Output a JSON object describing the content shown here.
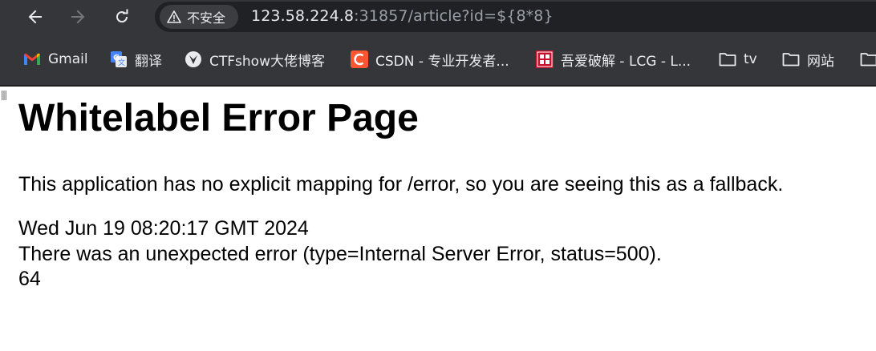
{
  "browser": {
    "nav": {
      "back_icon": "arrow-left-icon",
      "forward_icon": "arrow-right-icon",
      "reload_icon": "reload-icon"
    },
    "omnibox": {
      "security_label": "不安全",
      "url_host": "123.58.224.8",
      "url_rest": ":31857/article?id=${8*8}"
    }
  },
  "bookmarks": [
    {
      "label": "Gmail",
      "icon": "gmail-icon"
    },
    {
      "label": "翻译",
      "icon": "translate-icon"
    },
    {
      "label": "CTFshow大佬博客",
      "icon": "ctfshow-icon"
    },
    {
      "label": "CSDN - 专业开发者...",
      "icon": "csdn-icon"
    },
    {
      "label": "吾爱破解 - LCG - L...",
      "icon": "52pojie-icon"
    },
    {
      "label": "tv",
      "icon": "folder-icon"
    },
    {
      "label": "网站",
      "icon": "folder-icon"
    },
    {
      "label": "",
      "icon": "folder-icon"
    }
  ],
  "page": {
    "heading": "Whitelabel Error Page",
    "description": "This application has no explicit mapping for /error, so you are seeing this as a fallback.",
    "timestamp": "Wed Jun 19 08:20:17 GMT 2024",
    "error_line": "There was an unexpected error (type=Internal Server Error, status=500).",
    "result": "64"
  },
  "colors": {
    "toolbar_bg": "#35363a",
    "omnibox_bg": "#202124",
    "text_light": "#e8eaed",
    "text_dim": "#9aa0a6",
    "csdn_red": "#fc5531",
    "pojie_red": "#c8102e"
  }
}
